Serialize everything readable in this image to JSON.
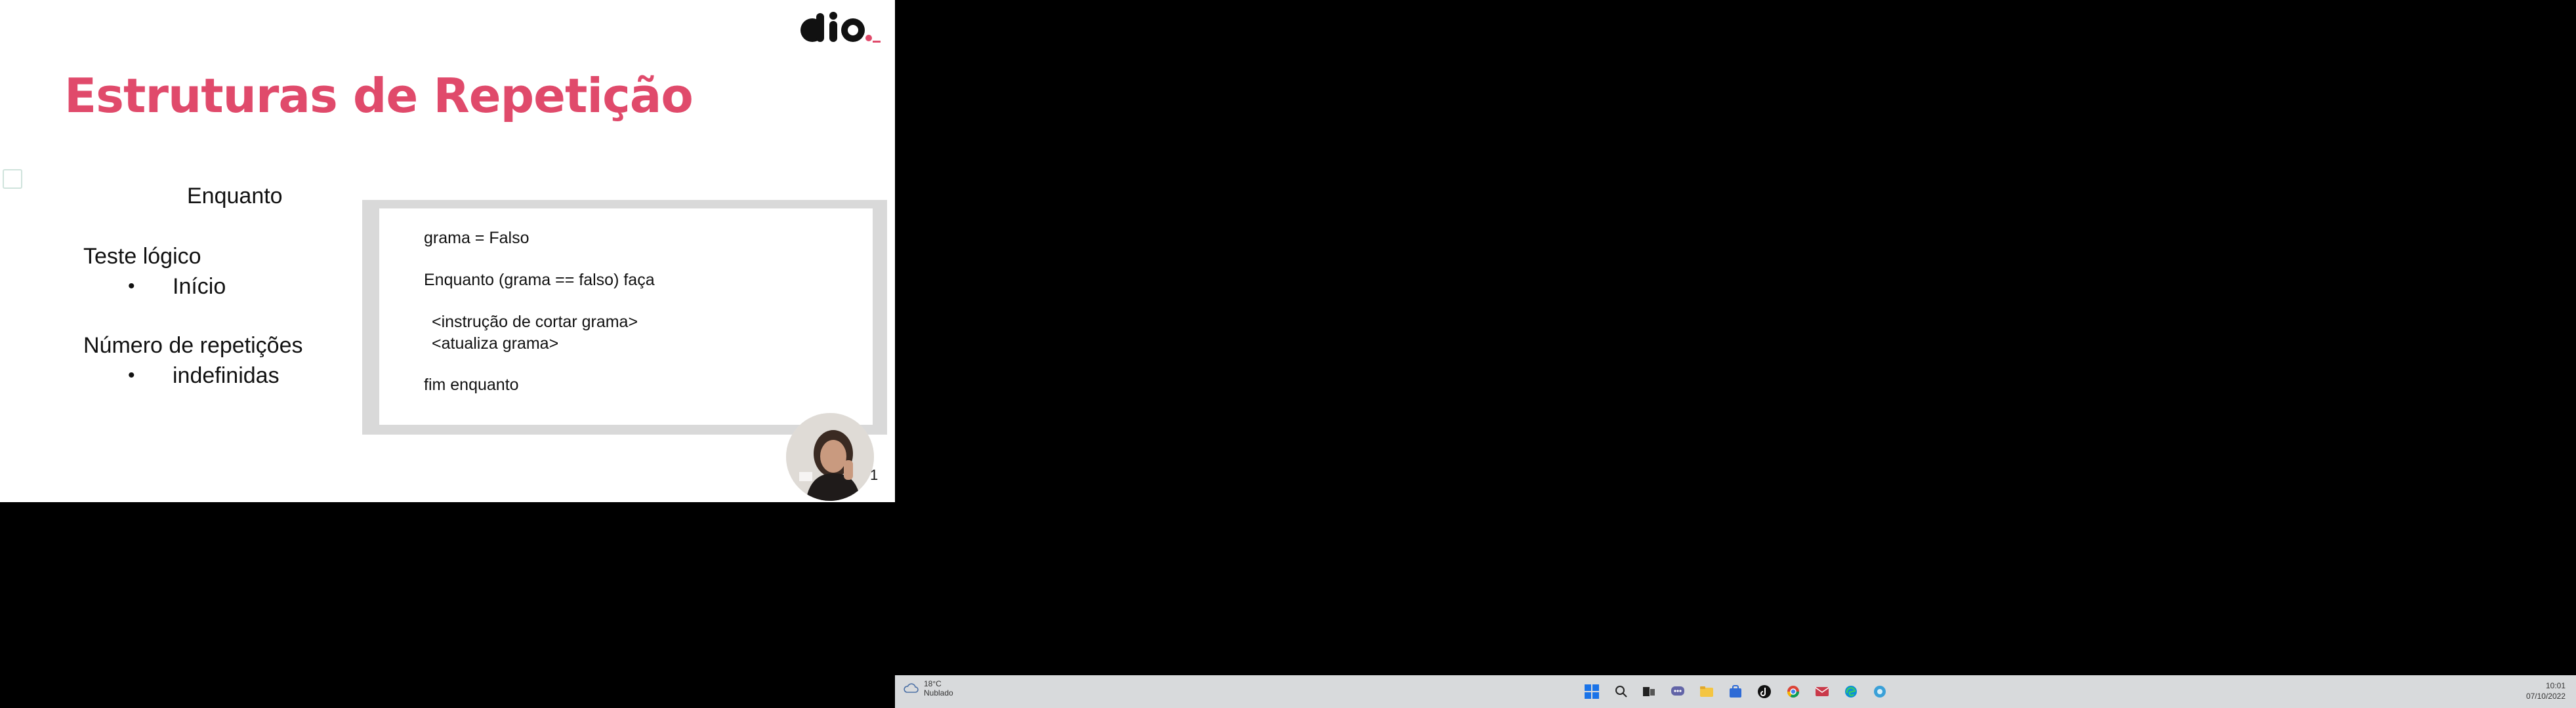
{
  "slide": {
    "title": "Estruturas de Repetição",
    "subtitle": "Enquanto",
    "left_block": {
      "teste_label": "Teste lógico",
      "teste_item": "Início",
      "repeticoes_label": "Número de repetições",
      "repeticoes_item": "indefinidas",
      "bullet_char": "•"
    },
    "code": {
      "line1": "grama = Falso",
      "line2": "Enquanto (grama == falso) faça",
      "line3": "<instrução de cortar grama>",
      "line4": "<atualiza grama>",
      "line5": "fim enquanto"
    },
    "slide_number": "1",
    "brand": {
      "logo_text": "dio",
      "accent": "#e04a6b"
    }
  },
  "taskbar": {
    "weather_temp": "18°C",
    "weather_desc": "Nublado",
    "time": "10:01",
    "date": "07/10/2022",
    "icons": [
      "windows-start-icon",
      "search-icon",
      "task-view-icon",
      "chat-icon",
      "file-explorer-icon",
      "store-icon",
      "tiktok-icon",
      "chrome-icon",
      "mail-icon",
      "edge-icon",
      "app-icon"
    ]
  }
}
